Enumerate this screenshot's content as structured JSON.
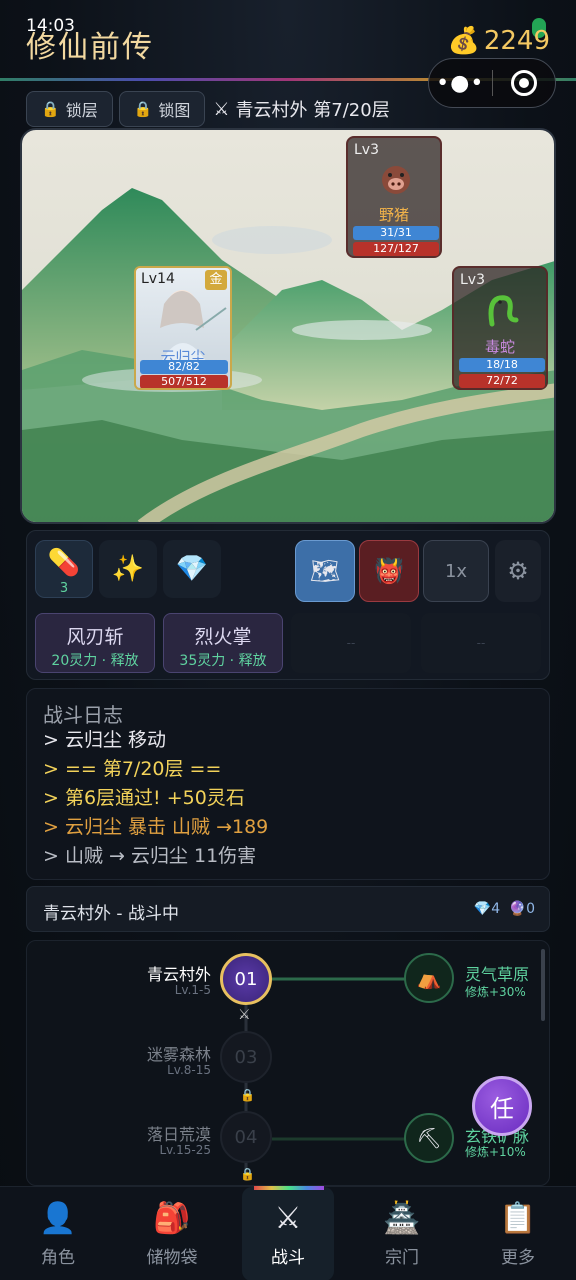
{
  "status": {
    "time": "14:03"
  },
  "header": {
    "title": "修仙前传",
    "gold_icon": "money-bag-icon",
    "gold": "2249"
  },
  "toolbar": {
    "lock_floor": "锁层",
    "lock_map": "锁图",
    "stage": "青云村外 第7/20层"
  },
  "scene": {
    "hero": {
      "level": "Lv14",
      "rank": "金",
      "name": "云归尘",
      "mp": "82/82",
      "hp": "507/512"
    },
    "enemies": [
      {
        "level": "Lv3",
        "name": "野猪",
        "mp": "31/31",
        "hp": "127/127",
        "icon": "boar-icon"
      },
      {
        "level": "Lv3",
        "name": "毒蛇",
        "mp": "18/18",
        "hp": "72/72",
        "icon": "snake-icon"
      }
    ]
  },
  "controls": {
    "items": [
      {
        "icon": "pill-icon",
        "count": "3"
      },
      {
        "icon": "sparkle-icon",
        "count": ""
      },
      {
        "icon": "gem-icon",
        "count": ""
      }
    ],
    "map_btn": "map-icon",
    "demon_btn": "demon-mask-icon",
    "speed": "1x",
    "settings": "gear-icon",
    "skills": [
      {
        "name": "风刃斩",
        "cost": "20灵力 · 释放"
      },
      {
        "name": "烈火掌",
        "cost": "35灵力 · 释放"
      }
    ],
    "empty_slot": "--"
  },
  "log": {
    "title": "战斗日志",
    "lines": [
      {
        "text": "> 云归尘 移动",
        "color": "#e8e8ee"
      },
      {
        "text": "> == 第7/20层 ==",
        "color": "#f2d25a"
      },
      {
        "text": "> 第6层通过! +50灵石",
        "color": "#f2d25a"
      },
      {
        "text": "> 云归尘 暴击 山贼 →189",
        "color": "#e0a040"
      },
      {
        "text": "> 山贼 → 云归尘 11伤害",
        "color": "#b8bcc4"
      }
    ]
  },
  "area": {
    "title": "青云村外 - 战斗中",
    "gems": "4",
    "orbs": "0"
  },
  "map": {
    "nodes": [
      {
        "name": "青云村外",
        "level": "Lv.1-5",
        "num": "01",
        "state": "current"
      },
      {
        "name": "迷雾森林",
        "level": "Lv.8-15",
        "num": "03",
        "state": "locked"
      },
      {
        "name": "落日荒漠",
        "level": "Lv.15-25",
        "num": "04",
        "state": "locked"
      }
    ],
    "side": [
      {
        "name": "灵气草原",
        "sub": "修炼+30%",
        "icon": "camp-icon"
      },
      {
        "name": "玄铁矿脉",
        "sub": "修炼+10%",
        "icon": "pickaxe-icon"
      }
    ],
    "task_label": "任"
  },
  "tabs": [
    {
      "label": "角色",
      "icon": "person-icon"
    },
    {
      "label": "储物袋",
      "icon": "backpack-icon"
    },
    {
      "label": "战斗",
      "icon": "crossed-swords-icon"
    },
    {
      "label": "宗门",
      "icon": "pagoda-icon"
    },
    {
      "label": "更多",
      "icon": "clipboard-icon"
    }
  ]
}
